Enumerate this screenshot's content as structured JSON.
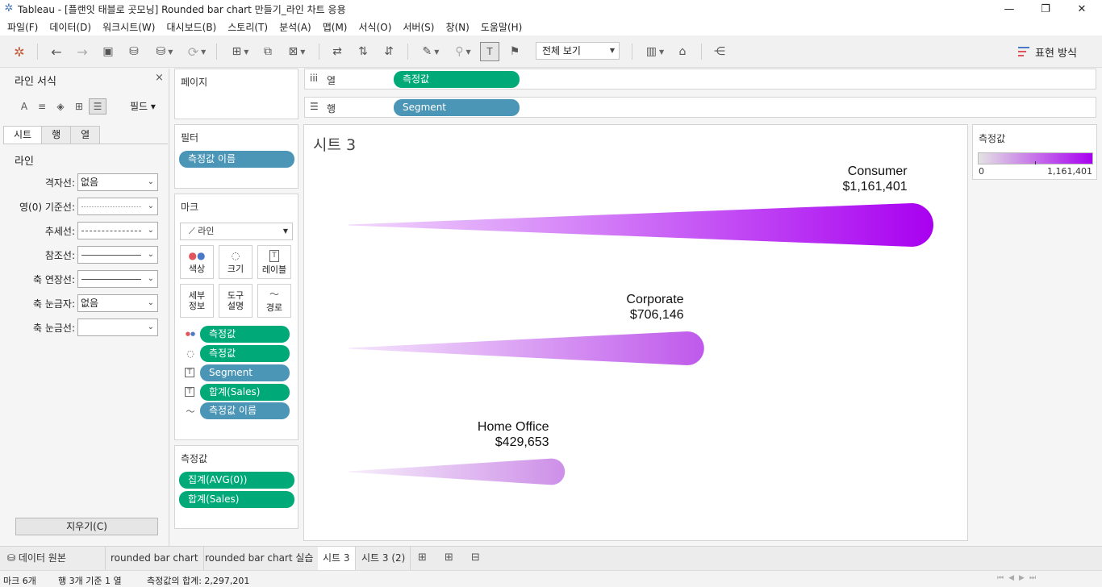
{
  "window": {
    "title": "Tableau - [플랜잇 태블로 곳모닝] Rounded bar chart 만들기_라인 차트 응용",
    "minimize": "—",
    "restore": "❐",
    "close": "✕"
  },
  "menu": [
    "파일(F)",
    "데이터(D)",
    "워크시트(W)",
    "대시보드(B)",
    "스토리(T)",
    "분석(A)",
    "맵(M)",
    "서식(O)",
    "서버(S)",
    "창(N)",
    "도움말(H)"
  ],
  "toolbar": {
    "view_select": "전체 보기",
    "show_me": "표현 방식"
  },
  "format_pane": {
    "title": "라인 서식",
    "close": "×",
    "field_label": "필드",
    "tabs": [
      "시트",
      "행",
      "열"
    ],
    "section": "라인",
    "rows": [
      {
        "label": "격자선:",
        "value": "없음"
      },
      {
        "label": "영(0) 기준선:",
        "value": ""
      },
      {
        "label": "추세선:",
        "value": ""
      },
      {
        "label": "참조선:",
        "value": ""
      },
      {
        "label": "축 연장선:",
        "value": ""
      },
      {
        "label": "축 눈금자:",
        "value": "없음"
      },
      {
        "label": "축 눈금선:",
        "value": ""
      }
    ],
    "clear_button": "지우기(C)"
  },
  "pages_card": {
    "title": "페이지"
  },
  "filters_card": {
    "title": "필터",
    "pills": [
      "측정값 이름"
    ]
  },
  "marks_card": {
    "title": "마크",
    "mark_type": "라인",
    "buttons": [
      {
        "label": "색상"
      },
      {
        "label": "크기"
      },
      {
        "label": "레이블"
      },
      {
        "label": "세부\n정보"
      },
      {
        "label": "도구\n설명"
      },
      {
        "label": "경로"
      }
    ],
    "encodings": [
      {
        "icon": "color-icon",
        "pill": "측정값",
        "color": "green"
      },
      {
        "icon": "size-icon",
        "pill": "측정값",
        "color": "green"
      },
      {
        "icon": "label-icon",
        "pill": "Segment",
        "color": "blue"
      },
      {
        "icon": "label-icon",
        "pill": "합계(Sales)",
        "color": "green"
      },
      {
        "icon": "path-icon",
        "pill": "측정값 이름",
        "color": "blue"
      }
    ]
  },
  "measures_card": {
    "title": "측정값",
    "pills": [
      "집계(AVG(0))",
      "합계(Sales)"
    ]
  },
  "shelves": {
    "columns": {
      "label": "열",
      "pill": "측정값"
    },
    "rows": {
      "label": "행",
      "pill": "Segment"
    }
  },
  "view": {
    "title": "시트 3"
  },
  "chart_data": {
    "type": "bar",
    "title": "시트 3",
    "categories": [
      "Consumer",
      "Corporate",
      "Home Office"
    ],
    "values": [
      1161401,
      706146,
      429653
    ],
    "value_labels": [
      "$1,161,401",
      "$706,146",
      "$429,653"
    ],
    "xlim": [
      0,
      1161401
    ],
    "xlabel": "",
    "ylabel": "",
    "grid": false,
    "color_ramp": {
      "start": "#e3e3e3",
      "end": "#a800f0"
    }
  },
  "legend": {
    "title": "측정값",
    "min_label": "0",
    "max_label": "1,161,401"
  },
  "sheet_tabs": [
    "데이터 원본",
    "rounded bar chart",
    "rounded bar chart 실습",
    "시트 3",
    "시트 3 (2)"
  ],
  "status": {
    "marks": "마크 6개",
    "rows_cols": "행 3개 기준 1 열",
    "sum": "측정값의 합계: 2,297,201"
  }
}
